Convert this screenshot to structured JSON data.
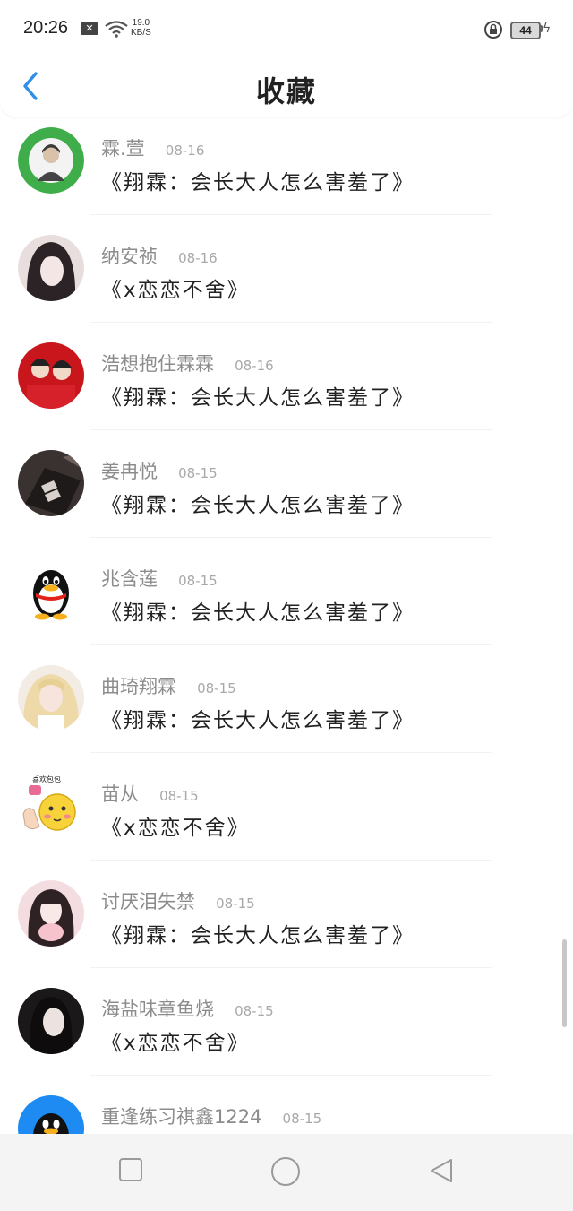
{
  "status_bar": {
    "time": "20:26",
    "net_speed_value": "19.0",
    "net_speed_unit": "KB/S",
    "battery": "44"
  },
  "header": {
    "title": "收藏",
    "back_icon": "chevron-left-icon",
    "accent_color": "#2f8fe8"
  },
  "favorites": [
    {
      "name": "霖.萱",
      "date": "08-16",
      "message": "《翔霖：会长大人怎么害羞了》",
      "avatar": "green-badge-photo"
    },
    {
      "name": "纳安祯",
      "date": "08-16",
      "message": "《x恋恋不舍》",
      "avatar": "anime-girl"
    },
    {
      "name": "浩想抱住霖霖",
      "date": "08-16",
      "message": "《翔霖：会长大人怎么害羞了》",
      "avatar": "two-boys-red"
    },
    {
      "name": "姜冉悦",
      "date": "08-15",
      "message": "《翔霖：会长大人怎么害羞了》",
      "avatar": "dark-photo"
    },
    {
      "name": "兆含莲",
      "date": "08-15",
      "message": "《翔霖：会长大人怎么害羞了》",
      "avatar": "qq-penguin"
    },
    {
      "name": "曲琦翔霖",
      "date": "08-15",
      "message": "《翔霖：会长大人怎么害羞了》",
      "avatar": "blonde-girl"
    },
    {
      "name": "苗从",
      "date": "08-15",
      "message": "《x恋恋不舍》",
      "avatar": "emoji-sticker",
      "avatar_caption": "喜欢包包"
    },
    {
      "name": "讨厌泪失禁",
      "date": "08-15",
      "message": "《翔霖：会长大人怎么害羞了》",
      "avatar": "girl-pink"
    },
    {
      "name": "海盐味章鱼烧",
      "date": "08-15",
      "message": "《x恋恋不舍》",
      "avatar": "girl-dark-hair"
    },
    {
      "name": "重逢练习祺鑫1224",
      "date": "08-15",
      "message": "",
      "avatar": "qq-penguin-blue"
    }
  ],
  "system_nav": {
    "icons": [
      "recent-apps-icon",
      "home-icon",
      "back-triangle-icon"
    ]
  }
}
